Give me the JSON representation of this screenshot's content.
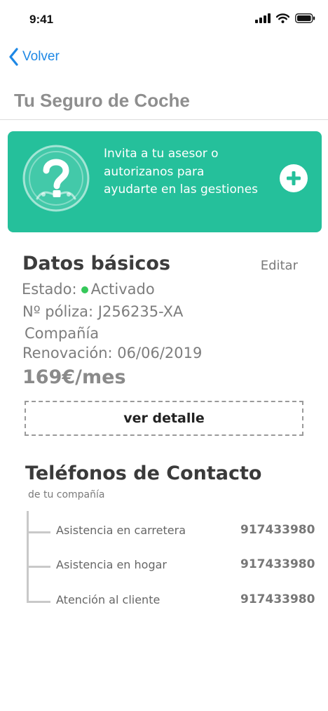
{
  "status_bar": {
    "time": "9:41",
    "icons": [
      "cellular-signal-icon",
      "wifi-icon",
      "battery-icon"
    ]
  },
  "nav": {
    "back_label": "Volver",
    "back_icon": "chevron-left-icon",
    "accent_color": "#1e88e5"
  },
  "page": {
    "title": "Tu Seguro de Coche"
  },
  "invite": {
    "lines": [
      "Invita a tu asesor o",
      "autorizanos para",
      "ayudarte en las gestiones"
    ],
    "icon": "question-help-icon",
    "action_icon": "plus-icon",
    "background_color": "#25c09b"
  },
  "basic_data": {
    "title": "Datos básicos",
    "edit_label": "Editar",
    "status_label": "Estado:",
    "status_value": "Activado",
    "status_color": "#35c85a",
    "policy": "Nº póliza: J256235-XA",
    "company": "Compañía",
    "renewal": "Renovación: 06/06/2019",
    "price": "169€/mes",
    "detail_button": "ver detalle"
  },
  "contacts": {
    "title": "Teléfonos de Contacto",
    "subtitle": "de tu compañía",
    "items": [
      {
        "label": "Asistencia en carretera",
        "phone": "917433980"
      },
      {
        "label": "Asistencia en hogar",
        "phone": "917433980"
      },
      {
        "label": "Atención al cliente",
        "phone": "917433980"
      }
    ]
  }
}
